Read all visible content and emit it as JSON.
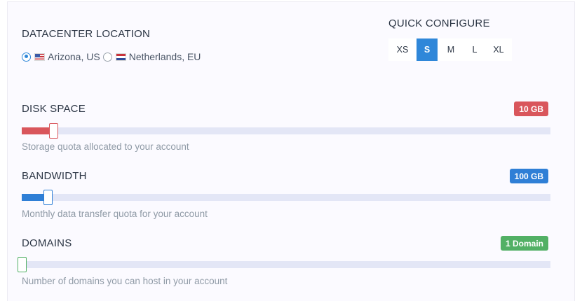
{
  "datacenter": {
    "heading": "DATACENTER LOCATION",
    "options": [
      {
        "label": "Arizona, US",
        "flag": "us-flag-icon",
        "selected": true
      },
      {
        "label": "Netherlands, EU",
        "flag": "nl-flag-icon",
        "selected": false
      }
    ]
  },
  "quick_configure": {
    "heading": "QUICK CONFIGURE",
    "options": [
      "XS",
      "S",
      "M",
      "L",
      "XL"
    ],
    "selected": "S"
  },
  "sliders": [
    {
      "heading": "DISK SPACE",
      "badge": "10 GB",
      "color": "#d9565c",
      "level_percent": 6,
      "hint": "Storage quota allocated to your account"
    },
    {
      "heading": "BANDWIDTH",
      "badge": "100 GB",
      "color": "#2f7fd6",
      "level_percent": 5,
      "hint": "Monthly data transfer quota for your account"
    },
    {
      "heading": "DOMAINS",
      "badge": "1 Domain",
      "color": "#52b065",
      "level_percent": 0,
      "hint": "Number of domains you can host in your account"
    }
  ]
}
